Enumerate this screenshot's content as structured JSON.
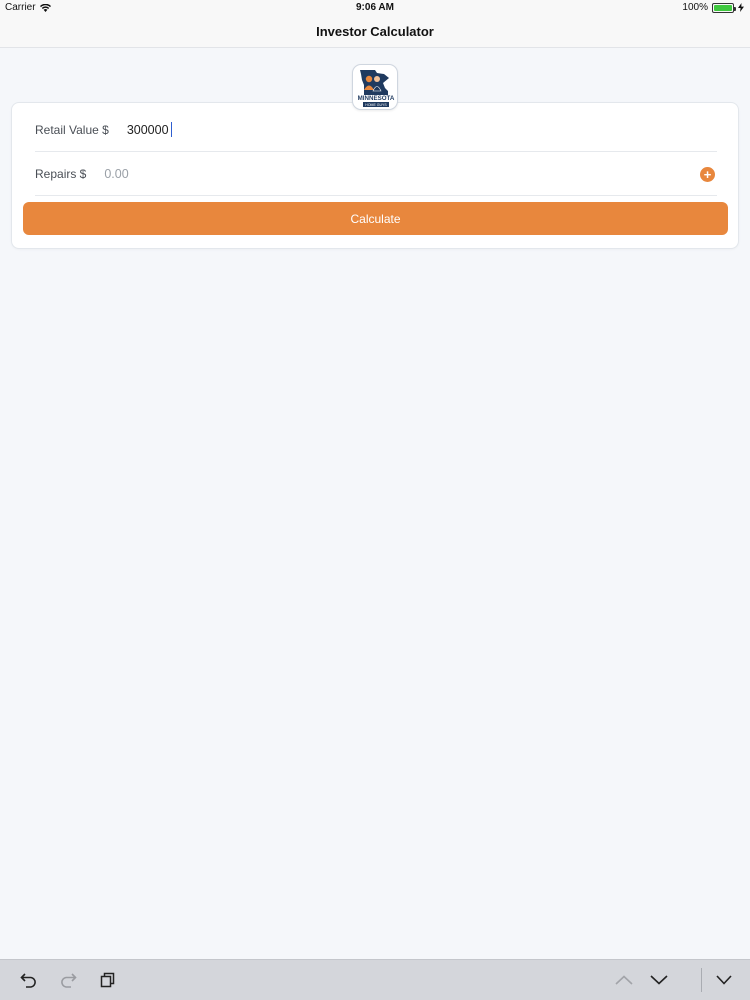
{
  "status_bar": {
    "carrier": "Carrier",
    "time": "9:06 AM",
    "battery": "100%"
  },
  "nav": {
    "title": "Investor Calculator"
  },
  "logo": {
    "text_line1": "MINNESOTA",
    "text_line2": "HOME GUYS"
  },
  "form": {
    "retail_label": "Retail Value $",
    "retail_value": "300000",
    "repairs_label": "Repairs $",
    "repairs_placeholder": "0.00",
    "add_label": "+",
    "calculate_label": "Calculate"
  },
  "colors": {
    "accent": "#e8873d",
    "background": "#f5f7fa"
  },
  "icons": {
    "toolbar": [
      "undo-icon",
      "redo-icon",
      "paste-icon",
      "chevron-up-icon",
      "chevron-down-icon",
      "hide-keyboard-icon"
    ]
  }
}
